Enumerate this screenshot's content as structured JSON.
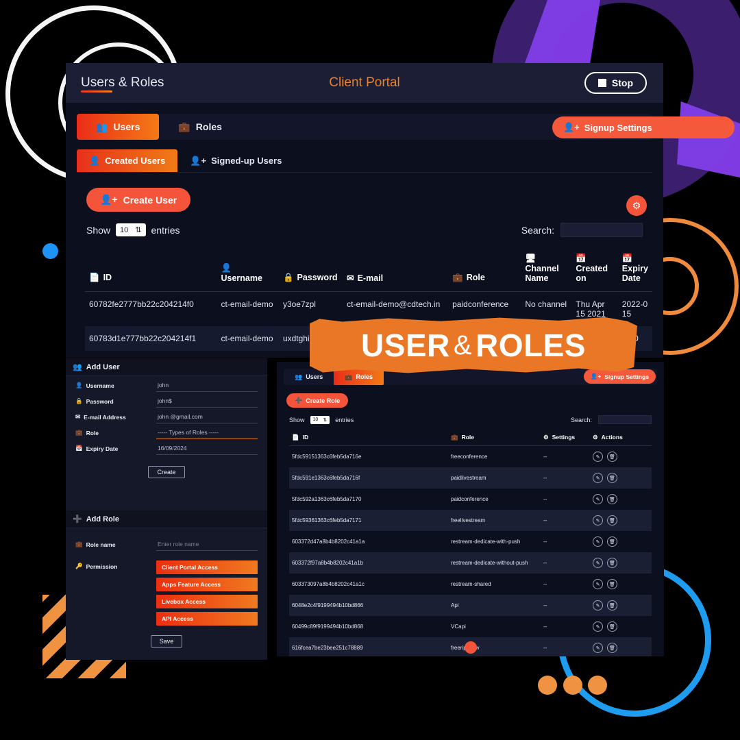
{
  "main_window": {
    "topbar": {
      "page_title": "Users & Roles",
      "center_title": "Client Portal",
      "stop_button": "Stop"
    },
    "tabs": [
      {
        "label": "Users",
        "icon": "users-icon",
        "active": true
      },
      {
        "label": "Roles",
        "icon": "briefcase-icon",
        "active": false
      }
    ],
    "subtabs": [
      {
        "label": "Created Users",
        "icon": "user-icon",
        "active": true
      },
      {
        "label": "Signed-up Users",
        "icon": "user-plus-icon",
        "active": false
      }
    ],
    "signup_settings_button": "Signup Settings",
    "create_user_button": "Create User",
    "show_entries": {
      "prefix": "Show",
      "value": "10",
      "suffix": "entries"
    },
    "search": {
      "label": "Search:",
      "value": ""
    },
    "table": {
      "columns": [
        {
          "label": "ID",
          "icon": "id-card-icon"
        },
        {
          "label": "Username",
          "icon": "user-icon"
        },
        {
          "label": "Password",
          "icon": "lock-icon"
        },
        {
          "label": "E-mail",
          "icon": "envelope-icon"
        },
        {
          "label": "Role",
          "icon": "briefcase-icon"
        },
        {
          "label": "Channel Name",
          "icon": "monitor-icon"
        },
        {
          "label": "Created on",
          "icon": "calendar-icon"
        },
        {
          "label": "Expiry Date",
          "icon": "calendar-icon"
        }
      ],
      "rows": [
        {
          "id": "60782fe2777bb22c204214f0",
          "username": "ct-email-demo",
          "password": "y3oe7zpl",
          "email": "ct-email-demo@cdtech.in",
          "role": "paidconference",
          "channel": "No channel",
          "created": "Thu Apr 15 2021",
          "expiry": "2022-0 15"
        },
        {
          "id": "60783d1e777bb22c204214f1",
          "username": "ct-email-demo",
          "password": "uxdtghiu",
          "email": "",
          "role": "",
          "channel": "",
          "created": "",
          "expiry": "21-0"
        }
      ]
    }
  },
  "banner": {
    "text_left": "USER",
    "amp": "&",
    "text_right": "ROLES"
  },
  "add_user": {
    "title": "Add User",
    "icon": "users-icon",
    "fields": [
      {
        "label": "Username",
        "icon": "user-icon",
        "value": "john",
        "accent": false
      },
      {
        "label": "Password",
        "icon": "lock-icon",
        "value": "john$",
        "accent": false
      },
      {
        "label": "E-mail Address",
        "icon": "envelope-icon",
        "value": "john @gmail.com",
        "accent": false
      },
      {
        "label": "Role",
        "icon": "briefcase-icon",
        "value": "----- Types of Roles -----",
        "accent": true
      },
      {
        "label": "Expiry Date",
        "icon": "calendar-icon",
        "value": "16/09/2024",
        "accent": false
      }
    ],
    "submit_button": "Create"
  },
  "add_role": {
    "title": "Add Role",
    "icon": "plus-circle-icon",
    "role_name_label": "Role name",
    "role_name_icon": "briefcase-icon",
    "role_name_placeholder": "Enter role name",
    "permission_label": "Permission",
    "permission_icon": "key-icon",
    "permissions": [
      "Client Portal Access",
      "Apps Feature Access",
      "Livebox Access",
      "API Access"
    ],
    "submit_button": "Save"
  },
  "roles_window": {
    "tabs": [
      {
        "label": "Users",
        "icon": "users-icon",
        "active": false
      },
      {
        "label": "Roles",
        "icon": "briefcase-icon",
        "active": true
      }
    ],
    "signup_settings_button": "Signup Settings",
    "create_role_button": "Create Role",
    "show_entries": {
      "prefix": "Show",
      "value": "10",
      "suffix": "entries"
    },
    "search": {
      "label": "Search:",
      "value": ""
    },
    "table": {
      "columns": [
        {
          "label": "ID",
          "icon": "id-card-icon"
        },
        {
          "label": "Role",
          "icon": "briefcase-icon"
        },
        {
          "label": "Settings",
          "icon": "gear-icon"
        },
        {
          "label": "Actions",
          "icon": "gears-icon"
        }
      ],
      "rows": [
        {
          "id": "5fdc59151363c6feb5da716e",
          "role": "freeconference",
          "settings": "--"
        },
        {
          "id": "5fdc591e1363c6feb5da716f",
          "role": "paidlivestream",
          "settings": "--"
        },
        {
          "id": "5fdc592a1363c6feb5da7170",
          "role": "paidconference",
          "settings": "--"
        },
        {
          "id": "5fdc59361363c6feb5da7171",
          "role": "freelivestream",
          "settings": "--"
        },
        {
          "id": "603372d47a8b4b8202c41a1a",
          "role": "restream-dedicate-with-push",
          "settings": "--"
        },
        {
          "id": "603372f97a8b4b8202c41a1b",
          "role": "restream-dedicate-without-push",
          "settings": "--"
        },
        {
          "id": "603373097a8b4b8202c41a1c",
          "role": "restream-shared",
          "settings": "--"
        },
        {
          "id": "6048e2c4f9199494b10bd866",
          "role": "Api",
          "settings": "--"
        },
        {
          "id": "60499c89f9199494b10bd868",
          "role": "VCapi",
          "settings": "--"
        },
        {
          "id": "616fcea7be23bee251c78889",
          "role": "freeripeflow",
          "settings": "--"
        }
      ],
      "action_icons": [
        "edit-icon",
        "delete-icon"
      ]
    }
  },
  "colors": {
    "accent_orange": "#f4553a",
    "gradient_start": "#ea2d18",
    "gradient_end": "#f47a16",
    "banner_orange": "#ea7726",
    "portal_text": "#e8822c",
    "blue_ring": "#1e9cf0",
    "blue_dot": "#1e93f7",
    "purple": "#8b3ff5",
    "panel_bg": "#0c0f1e",
    "topbar_bg": "#1b1e35"
  }
}
